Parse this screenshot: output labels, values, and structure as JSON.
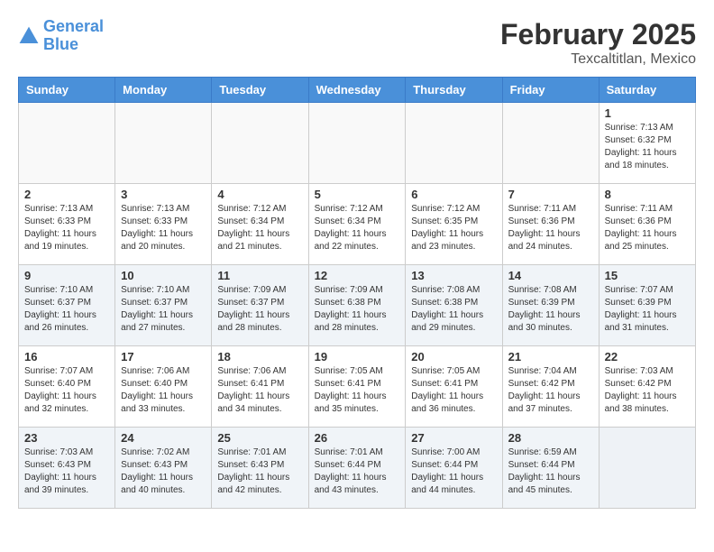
{
  "header": {
    "logo_line1": "General",
    "logo_line2": "Blue",
    "month_title": "February 2025",
    "location": "Texcaltitlan, Mexico"
  },
  "days_of_week": [
    "Sunday",
    "Monday",
    "Tuesday",
    "Wednesday",
    "Thursday",
    "Friday",
    "Saturday"
  ],
  "weeks": [
    {
      "shade": false,
      "days": [
        {
          "number": "",
          "info": ""
        },
        {
          "number": "",
          "info": ""
        },
        {
          "number": "",
          "info": ""
        },
        {
          "number": "",
          "info": ""
        },
        {
          "number": "",
          "info": ""
        },
        {
          "number": "",
          "info": ""
        },
        {
          "number": "1",
          "info": "Sunrise: 7:13 AM\nSunset: 6:32 PM\nDaylight: 11 hours\nand 18 minutes."
        }
      ]
    },
    {
      "shade": false,
      "days": [
        {
          "number": "2",
          "info": "Sunrise: 7:13 AM\nSunset: 6:33 PM\nDaylight: 11 hours\nand 19 minutes."
        },
        {
          "number": "3",
          "info": "Sunrise: 7:13 AM\nSunset: 6:33 PM\nDaylight: 11 hours\nand 20 minutes."
        },
        {
          "number": "4",
          "info": "Sunrise: 7:12 AM\nSunset: 6:34 PM\nDaylight: 11 hours\nand 21 minutes."
        },
        {
          "number": "5",
          "info": "Sunrise: 7:12 AM\nSunset: 6:34 PM\nDaylight: 11 hours\nand 22 minutes."
        },
        {
          "number": "6",
          "info": "Sunrise: 7:12 AM\nSunset: 6:35 PM\nDaylight: 11 hours\nand 23 minutes."
        },
        {
          "number": "7",
          "info": "Sunrise: 7:11 AM\nSunset: 6:36 PM\nDaylight: 11 hours\nand 24 minutes."
        },
        {
          "number": "8",
          "info": "Sunrise: 7:11 AM\nSunset: 6:36 PM\nDaylight: 11 hours\nand 25 minutes."
        }
      ]
    },
    {
      "shade": true,
      "days": [
        {
          "number": "9",
          "info": "Sunrise: 7:10 AM\nSunset: 6:37 PM\nDaylight: 11 hours\nand 26 minutes."
        },
        {
          "number": "10",
          "info": "Sunrise: 7:10 AM\nSunset: 6:37 PM\nDaylight: 11 hours\nand 27 minutes."
        },
        {
          "number": "11",
          "info": "Sunrise: 7:09 AM\nSunset: 6:37 PM\nDaylight: 11 hours\nand 28 minutes."
        },
        {
          "number": "12",
          "info": "Sunrise: 7:09 AM\nSunset: 6:38 PM\nDaylight: 11 hours\nand 28 minutes."
        },
        {
          "number": "13",
          "info": "Sunrise: 7:08 AM\nSunset: 6:38 PM\nDaylight: 11 hours\nand 29 minutes."
        },
        {
          "number": "14",
          "info": "Sunrise: 7:08 AM\nSunset: 6:39 PM\nDaylight: 11 hours\nand 30 minutes."
        },
        {
          "number": "15",
          "info": "Sunrise: 7:07 AM\nSunset: 6:39 PM\nDaylight: 11 hours\nand 31 minutes."
        }
      ]
    },
    {
      "shade": false,
      "days": [
        {
          "number": "16",
          "info": "Sunrise: 7:07 AM\nSunset: 6:40 PM\nDaylight: 11 hours\nand 32 minutes."
        },
        {
          "number": "17",
          "info": "Sunrise: 7:06 AM\nSunset: 6:40 PM\nDaylight: 11 hours\nand 33 minutes."
        },
        {
          "number": "18",
          "info": "Sunrise: 7:06 AM\nSunset: 6:41 PM\nDaylight: 11 hours\nand 34 minutes."
        },
        {
          "number": "19",
          "info": "Sunrise: 7:05 AM\nSunset: 6:41 PM\nDaylight: 11 hours\nand 35 minutes."
        },
        {
          "number": "20",
          "info": "Sunrise: 7:05 AM\nSunset: 6:41 PM\nDaylight: 11 hours\nand 36 minutes."
        },
        {
          "number": "21",
          "info": "Sunrise: 7:04 AM\nSunset: 6:42 PM\nDaylight: 11 hours\nand 37 minutes."
        },
        {
          "number": "22",
          "info": "Sunrise: 7:03 AM\nSunset: 6:42 PM\nDaylight: 11 hours\nand 38 minutes."
        }
      ]
    },
    {
      "shade": true,
      "days": [
        {
          "number": "23",
          "info": "Sunrise: 7:03 AM\nSunset: 6:43 PM\nDaylight: 11 hours\nand 39 minutes."
        },
        {
          "number": "24",
          "info": "Sunrise: 7:02 AM\nSunset: 6:43 PM\nDaylight: 11 hours\nand 40 minutes."
        },
        {
          "number": "25",
          "info": "Sunrise: 7:01 AM\nSunset: 6:43 PM\nDaylight: 11 hours\nand 42 minutes."
        },
        {
          "number": "26",
          "info": "Sunrise: 7:01 AM\nSunset: 6:44 PM\nDaylight: 11 hours\nand 43 minutes."
        },
        {
          "number": "27",
          "info": "Sunrise: 7:00 AM\nSunset: 6:44 PM\nDaylight: 11 hours\nand 44 minutes."
        },
        {
          "number": "28",
          "info": "Sunrise: 6:59 AM\nSunset: 6:44 PM\nDaylight: 11 hours\nand 45 minutes."
        },
        {
          "number": "",
          "info": ""
        }
      ]
    }
  ]
}
